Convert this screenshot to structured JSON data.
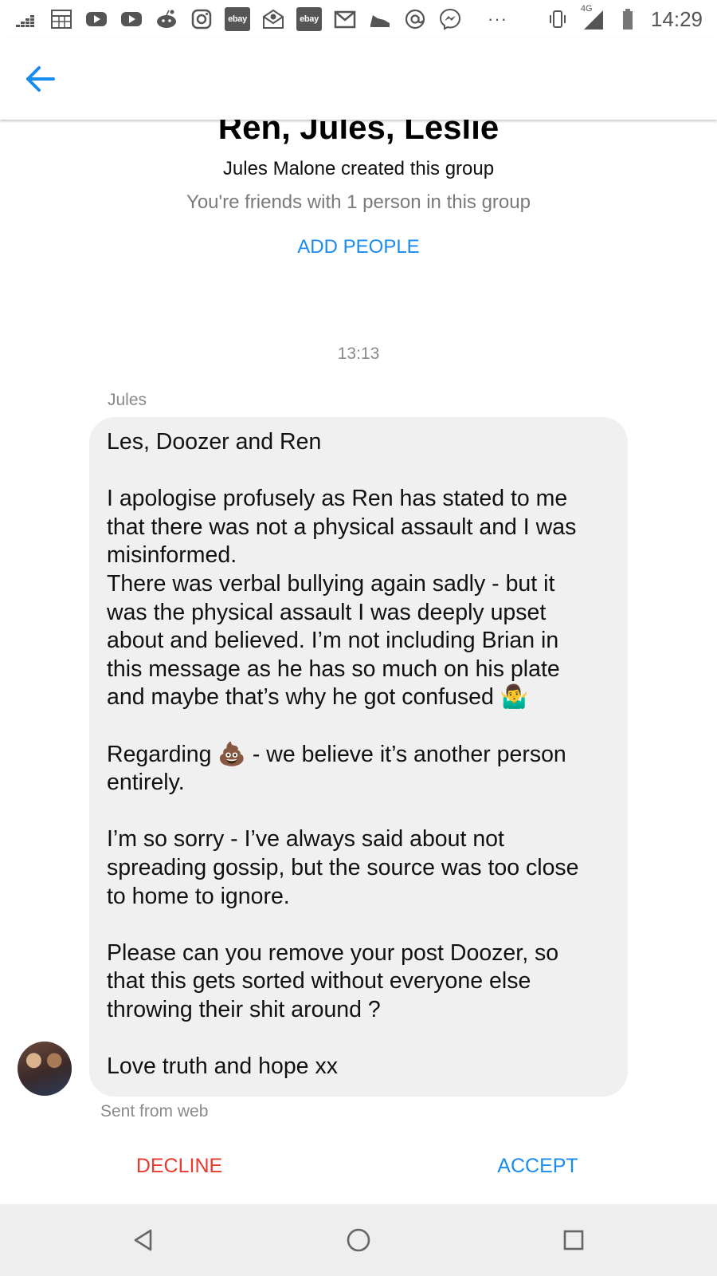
{
  "status_bar": {
    "time": "14:29",
    "network": "4G",
    "left_icons": [
      "deezer-icon",
      "spreadsheet-icon",
      "youtube-icon",
      "youtube-icon",
      "reddit-icon",
      "instagram-icon",
      "ebay-icon",
      "mail-icon",
      "ebay-icon",
      "gmail-icon",
      "shoe-icon",
      "at-icon",
      "messenger-icon"
    ],
    "ebay_label": "ebay",
    "more": "···"
  },
  "header": {
    "back_icon": "arrow-left-icon"
  },
  "group": {
    "title": "Ren, Jules, Leslie",
    "created_by": "Jules Malone created this group",
    "friends_info": "You're friends with 1 person in this group",
    "add_people_label": "ADD PEOPLE"
  },
  "conversation": {
    "timestamp": "13:13",
    "sender": "Jules",
    "message_lines": [
      "Les, Doozer and Ren",
      "",
      "I apologise profusely as Ren has stated to me",
      "that there was not a physical assault and I was",
      "misinformed.",
      "There was verbal bullying again sadly - but it",
      "was the physical assault I was deeply upset",
      "about and believed. I’m not including Brian in",
      "this message as he has so much on his plate",
      "and maybe that’s why he got confused 🤷‍♂️",
      "",
      "Regarding 💩 - we believe it’s another person",
      "entirely.",
      "",
      "I’m so sorry - I’ve always said about not",
      "spreading gossip, but the source was too close",
      "to home to ignore.",
      "",
      "Please can you remove your post Doozer, so",
      "that this gets sorted without everyone else",
      "throwing their shit around ?",
      "",
      "Love truth and hope xx"
    ],
    "sent_from": "Sent from web"
  },
  "actions": {
    "decline_label": "DECLINE",
    "accept_label": "ACCEPT"
  },
  "nav": {
    "back_icon": "triangle-back-icon",
    "home_icon": "circle-home-icon",
    "recents_icon": "square-recents-icon"
  },
  "colors": {
    "accent_blue": "#1a8cf0",
    "decline_red": "#e63b2e",
    "bubble_gray": "#f0f0f0",
    "muted_text": "#8a8a8a"
  }
}
